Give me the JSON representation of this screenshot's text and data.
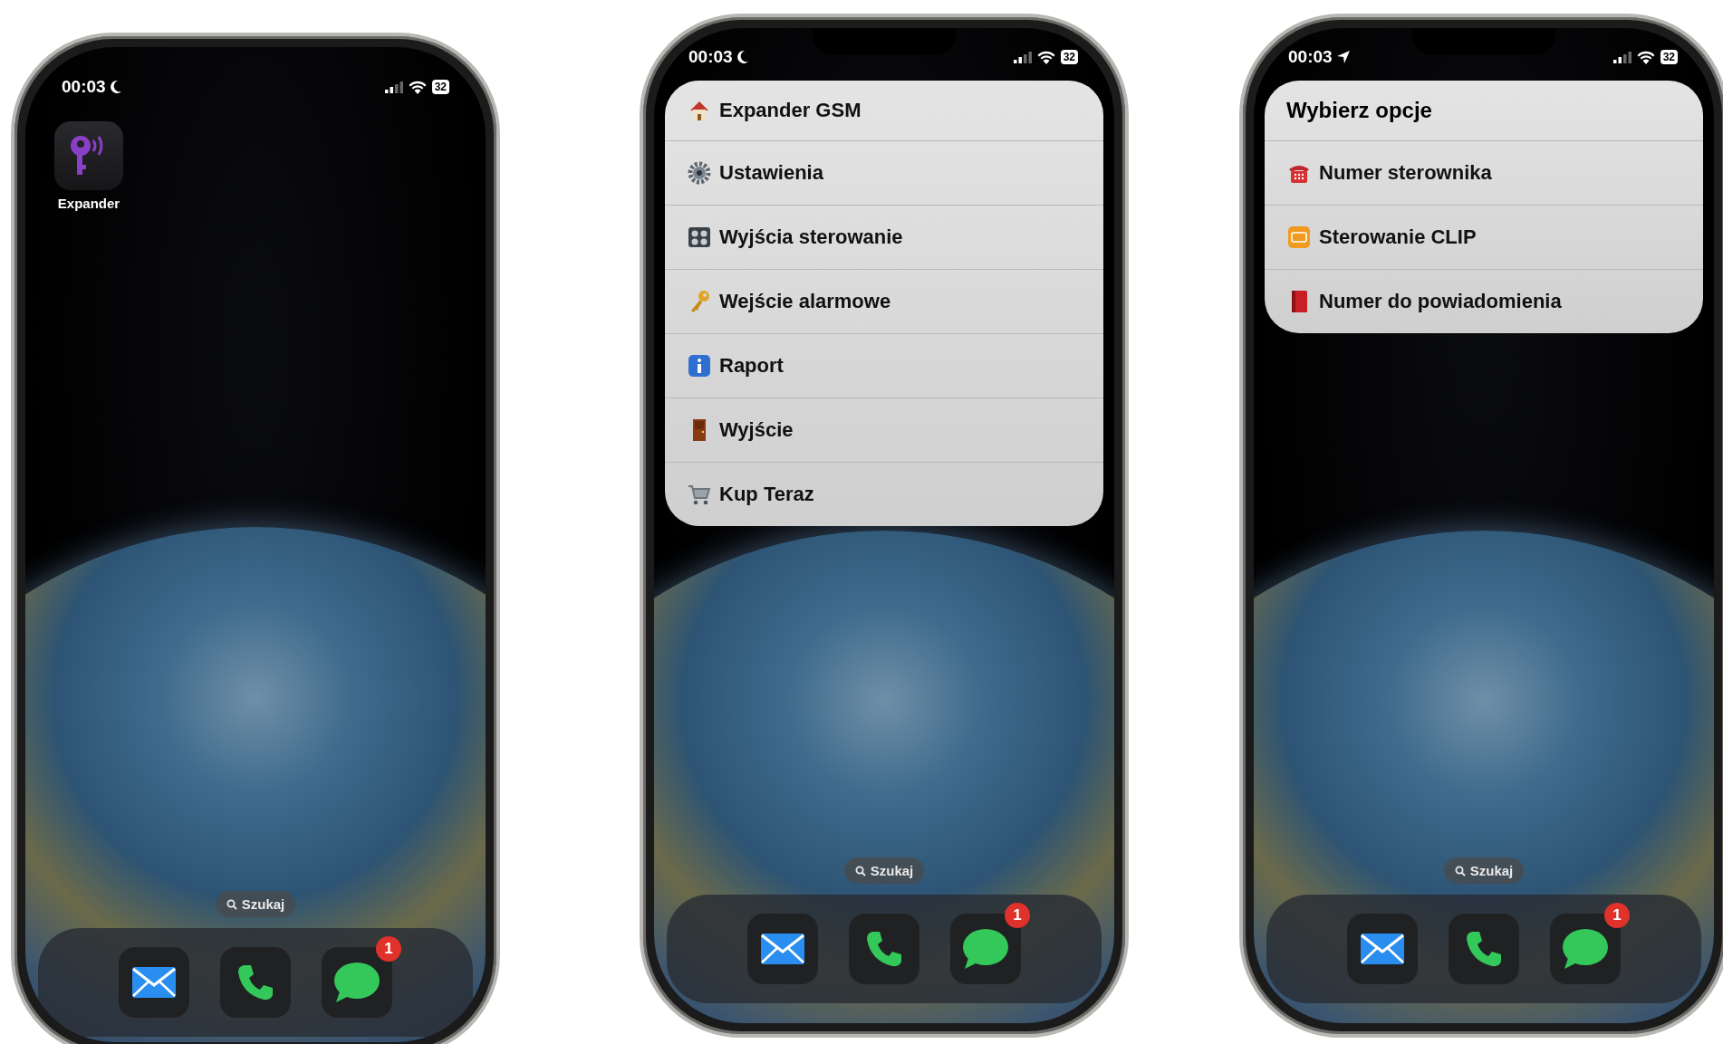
{
  "phones": [
    {
      "status": {
        "time": "00:03",
        "kind": "moon",
        "battery": "32"
      },
      "home_apps": [
        {
          "label": "Expander"
        }
      ],
      "search": {
        "label": "Szukaj"
      },
      "dock": [
        {
          "kind": "mail"
        },
        {
          "kind": "phone"
        },
        {
          "kind": "messages",
          "badge": "1"
        }
      ]
    },
    {
      "status": {
        "time": "00:03",
        "kind": "moon",
        "battery": "32"
      },
      "menu": {
        "items": [
          {
            "label": "Expander GSM"
          },
          {
            "label": "Ustawienia"
          },
          {
            "label": "Wyjścia sterowanie"
          },
          {
            "label": "Wejście alarmowe"
          },
          {
            "label": "Raport"
          },
          {
            "label": "Wyjście"
          },
          {
            "label": "Kup Teraz"
          }
        ]
      },
      "search": {
        "label": "Szukaj"
      },
      "dock": [
        {
          "kind": "mail"
        },
        {
          "kind": "phone"
        },
        {
          "kind": "messages",
          "badge": "1"
        }
      ]
    },
    {
      "status": {
        "time": "00:03",
        "kind": "location",
        "battery": "32"
      },
      "menu": {
        "items": [
          {
            "label": "Wybierz opcje",
            "kind": "title"
          },
          {
            "label": "Numer sterownika"
          },
          {
            "label": "Sterowanie CLIP"
          },
          {
            "label": "Numer do powiadomienia"
          }
        ]
      },
      "search": {
        "label": "Szukaj"
      },
      "dock": [
        {
          "kind": "mail"
        },
        {
          "kind": "phone"
        },
        {
          "kind": "messages",
          "badge": "1"
        }
      ]
    }
  ]
}
